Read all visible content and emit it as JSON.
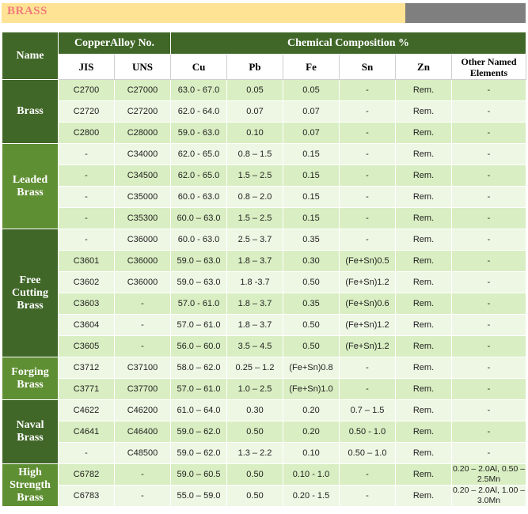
{
  "title": "BRASS",
  "headers": {
    "name": "Name",
    "alloy_no": "CopperAlloy No.",
    "chem": "Chemical Composition %",
    "jis": "JIS",
    "uns": "UNS",
    "cu": "Cu",
    "pb": "Pb",
    "fe": "Fe",
    "sn": "Sn",
    "zn": "Zn",
    "other": "Other Named Elements"
  },
  "groups": [
    {
      "name": "Brass",
      "rows": [
        [
          "C2700",
          "C27000",
          "63.0 - 67.0",
          "0.05",
          "0.05",
          "-",
          "Rem.",
          "-"
        ],
        [
          "C2720",
          "C27200",
          "62.0 - 64.0",
          "0.07",
          "0.07",
          "-",
          "Rem.",
          "-"
        ],
        [
          "C2800",
          "C28000",
          "59.0 - 63.0",
          "0.10",
          "0.07",
          "-",
          "Rem.",
          "-"
        ]
      ]
    },
    {
      "name": "Leaded Brass",
      "rows": [
        [
          "-",
          "C34000",
          "62.0 - 65.0",
          "0.8 – 1.5",
          "0.15",
          "-",
          "Rem.",
          "-"
        ],
        [
          "-",
          "C34500",
          "62.0 - 65.0",
          "1.5 – 2.5",
          "0.15",
          "-",
          "Rem.",
          "-"
        ],
        [
          "-",
          "C35000",
          "60.0 - 63.0",
          "0.8 – 2.0",
          "0.15",
          "-",
          "Rem.",
          "-"
        ],
        [
          "-",
          "C35300",
          "60.0 – 63.0",
          "1.5 – 2.5",
          "0.15",
          "-",
          "Rem.",
          "-"
        ]
      ]
    },
    {
      "name": "Free Cutting Brass",
      "rows": [
        [
          "-",
          "C36000",
          "60.0 - 63.0",
          "2.5 – 3.7",
          "0.35",
          "-",
          "Rem.",
          "-"
        ],
        [
          "C3601",
          "C36000",
          "59.0 – 63.0",
          "1.8 – 3.7",
          "0.30",
          "(Fe+Sn)0.5",
          "Rem.",
          "-"
        ],
        [
          "C3602",
          "C36000",
          "59.0 – 63.0",
          "1.8 -3.7",
          "0.50",
          "(Fe+Sn)1.2",
          "Rem.",
          "-"
        ],
        [
          "C3603",
          "-",
          "57.0 - 61.0",
          "1.8 – 3.7",
          "0.35",
          "(Fe+Sn)0.6",
          "Rem.",
          "-"
        ],
        [
          "C3604",
          "-",
          "57.0 – 61.0",
          "1.8 – 3.7",
          "0.50",
          "(Fe+Sn)1.2",
          "Rem.",
          "-"
        ],
        [
          "C3605",
          "-",
          "56.0 – 60.0",
          "3.5 – 4.5",
          "0.50",
          "(Fe+Sn)1.2",
          "Rem.",
          "-"
        ]
      ]
    },
    {
      "name": "Forging Brass",
      "rows": [
        [
          "C3712",
          "C37100",
          "58.0 – 62.0",
          "0.25 – 1.2",
          "(Fe+Sn)0.8",
          "-",
          "Rem.",
          "-"
        ],
        [
          "C3771",
          "C37700",
          "57.0 – 61.0",
          "1.0 – 2.5",
          "(Fe+Sn)1.0",
          "-",
          "Rem.",
          "-"
        ]
      ]
    },
    {
      "name": "Naval Brass",
      "rows": [
        [
          "C4622",
          "C46200",
          "61.0 – 64.0",
          "0.30",
          "0.20",
          "0.7 – 1.5",
          "Rem.",
          "-"
        ],
        [
          "C4641",
          "C46400",
          "59.0 – 62.0",
          "0.50",
          "0.20",
          "0.50 - 1.0",
          "Rem.",
          "-"
        ],
        [
          "-",
          "C48500",
          "59.0 – 62.0",
          "1.3 – 2.2",
          "0.10",
          "0.50 – 1.0",
          "Rem.",
          "-"
        ]
      ]
    },
    {
      "name": "High Strength Brass",
      "rows": [
        [
          "C6782",
          "-",
          "59.0 – 60.5",
          "0.50",
          "0.10 - 1.0",
          "-",
          "Rem.",
          "0.20 – 2.0Al, 0.50 – 2.5Mn"
        ],
        [
          "C6783",
          "-",
          "55.0 – 59.0",
          "0.50",
          "0.20 - 1.5",
          "-",
          "Rem.",
          "0.20 – 2.0Al, 1.00 – 3.0Mn"
        ]
      ]
    }
  ]
}
